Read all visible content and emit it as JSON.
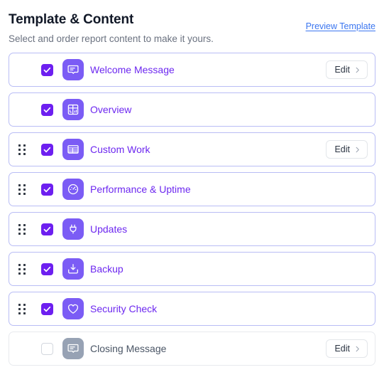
{
  "header": {
    "title": "Template & Content",
    "subtitle": "Select and order report content to make it yours.",
    "preview_link": "Preview Template"
  },
  "colors": {
    "accent_purple": "#6d28f0",
    "tile_purple": "#7b5cf5",
    "checkbox_purple": "#6d1ff0",
    "row_border_active": "#b9bdf5",
    "row_border_inactive": "#e8eaee",
    "inactive_tile_gray": "#97a2b4",
    "inactive_text_gray": "#4a5565",
    "link_blue": "#3b76f0"
  },
  "edit_label": "Edit",
  "rows": [
    {
      "label": "Welcome Message",
      "icon": "message-bubble-icon",
      "checked": true,
      "draggable": false,
      "has_edit": true,
      "edit_label": "Edit"
    },
    {
      "label": "Overview",
      "icon": "dashboard-layout-icon",
      "checked": true,
      "draggable": false,
      "has_edit": false,
      "edit_label": "Edit"
    },
    {
      "label": "Custom Work",
      "icon": "table-rows-icon",
      "checked": true,
      "draggable": true,
      "has_edit": true,
      "edit_label": "Edit"
    },
    {
      "label": "Performance & Uptime",
      "icon": "gauge-icon",
      "checked": true,
      "draggable": true,
      "has_edit": false,
      "edit_label": "Edit"
    },
    {
      "label": "Updates",
      "icon": "plug-icon",
      "checked": true,
      "draggable": true,
      "has_edit": false,
      "edit_label": "Edit"
    },
    {
      "label": "Backup",
      "icon": "backup-download-icon",
      "checked": true,
      "draggable": true,
      "has_edit": false,
      "edit_label": "Edit"
    },
    {
      "label": "Security Check",
      "icon": "heart-shield-icon",
      "checked": true,
      "draggable": true,
      "has_edit": false,
      "edit_label": "Edit"
    },
    {
      "label": "Closing Message",
      "icon": "message-bubble-icon",
      "checked": false,
      "draggable": false,
      "has_edit": true,
      "edit_label": "Edit"
    }
  ]
}
